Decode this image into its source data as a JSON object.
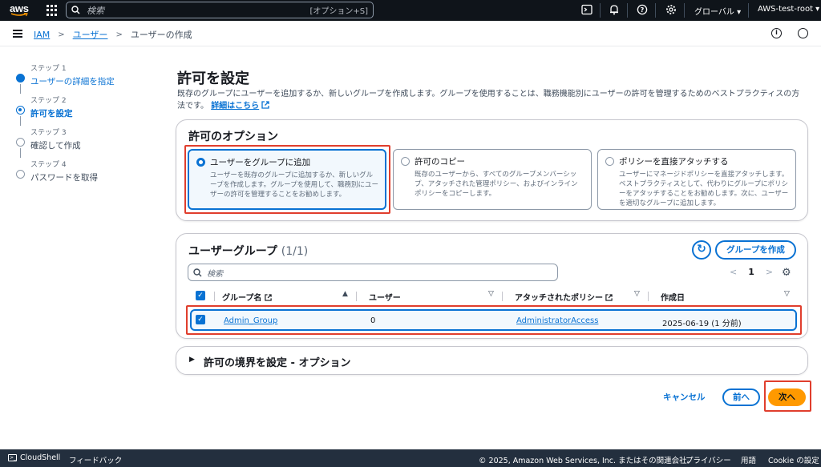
{
  "topnav": {
    "logo_text": "aws",
    "search_placeholder": "検索",
    "search_shortcut": "[オプション+S]",
    "region": "グローバル ▾",
    "account": "AWS-test-root ▾"
  },
  "breadcrumb": {
    "items": [
      "IAM",
      "ユーザー",
      "ユーザーの作成"
    ]
  },
  "steps": [
    {
      "num": "ステップ 1",
      "title": "ユーザーの詳細を指定",
      "state": "done"
    },
    {
      "num": "ステップ 2",
      "title": "許可を設定",
      "state": "active"
    },
    {
      "num": "ステップ 3",
      "title": "確認して作成",
      "state": "pending"
    },
    {
      "num": "ステップ 4",
      "title": "パスワードを取得",
      "state": "pending"
    }
  ],
  "main": {
    "title": "許可を設定",
    "description": "既存のグループにユーザーを追加するか、新しいグループを作成します。グループを使用することは、職務機能別にユーザーの許可を管理するためのベストプラクティスの方法です。",
    "learn_more": "詳細はこちら"
  },
  "permission_options": {
    "heading": "許可のオプション",
    "options": [
      {
        "title": "ユーザーをグループに追加",
        "desc": "ユーザーを既存のグループに追加するか、新しいグループを作成します。グループを使用して、職務別にユーザーの許可を管理することをお勧めします。",
        "selected": true
      },
      {
        "title": "許可のコピー",
        "desc": "既存のユーザーから、すべてのグループメンバーシップ、アタッチされた管理ポリシー、およびインラインポリシーをコピーします。",
        "selected": false
      },
      {
        "title": "ポリシーを直接アタッチする",
        "desc": "ユーザーにマネージドポリシーを直接アタッチします。ベストプラクティスとして、代わりにグループにポリシーをアタッチすることをお勧めします。次に、ユーザーを適切なグループに追加します。",
        "selected": false
      }
    ]
  },
  "user_groups": {
    "heading": "ユーザーグループ",
    "count": "(1/1)",
    "create_label": "グループを作成",
    "filter_placeholder": "検索",
    "page": "1",
    "columns": [
      "グループ名",
      "ユーザー",
      "アタッチされたポリシー",
      "作成日"
    ],
    "rows": [
      {
        "name": "Admin_Group",
        "users": "0",
        "policy": "AdministratorAccess",
        "created": "2025-06-19 (1 分前)"
      }
    ]
  },
  "boundary": {
    "heading": "許可の境界を設定 - オプション"
  },
  "actions": {
    "cancel": "キャンセル",
    "previous": "前へ",
    "next": "次へ"
  },
  "footer": {
    "cloudshell": "CloudShell",
    "feedback": "フィードバック",
    "copyright": "© 2025, Amazon Web Services, Inc. またはその関連会社。",
    "privacy": "プライバシー",
    "terms": "用語",
    "cookie": "Cookie の設定"
  },
  "colors": {
    "accent": "#0972d3",
    "nav_bg": "#0f141a",
    "primary_button": "#ff9900",
    "highlight_border": "#e03e2d"
  }
}
